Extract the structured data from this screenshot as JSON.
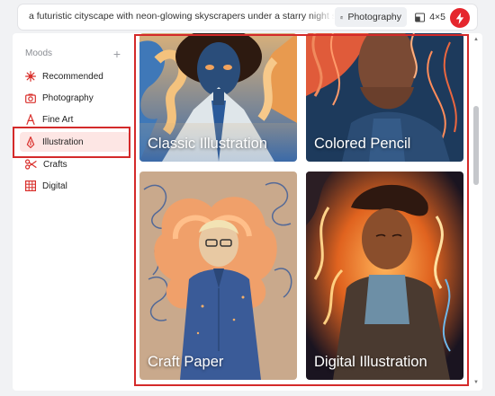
{
  "prompt": {
    "text": "a futuristic cityscape with neon-glowing skyscrapers under a starry night sky"
  },
  "toolbar": {
    "style_label": "Photography",
    "ratio_label": "4×5",
    "generate_icon": "lightning-icon",
    "accent_color": "#e5262d"
  },
  "sidebar": {
    "title": "Moods",
    "add_icon": "plus-icon",
    "items": [
      {
        "label": "Recommended",
        "icon": "sparkle-icon"
      },
      {
        "label": "Photography",
        "icon": "camera-icon"
      },
      {
        "label": "Fine Art",
        "icon": "easel-icon"
      },
      {
        "label": "Illustration",
        "icon": "pen-nib-icon",
        "selected": true
      },
      {
        "label": "Crafts",
        "icon": "scissors-icon"
      },
      {
        "label": "Digital",
        "icon": "grid-icon"
      }
    ]
  },
  "styles": [
    {
      "label": "Classic Illustration"
    },
    {
      "label": "Colored Pencil"
    },
    {
      "label": "Craft Paper"
    },
    {
      "label": "Digital Illustration"
    }
  ],
  "colors": {
    "selection_outline": "#d42a2a",
    "selected_bg": "#fde6e4"
  }
}
